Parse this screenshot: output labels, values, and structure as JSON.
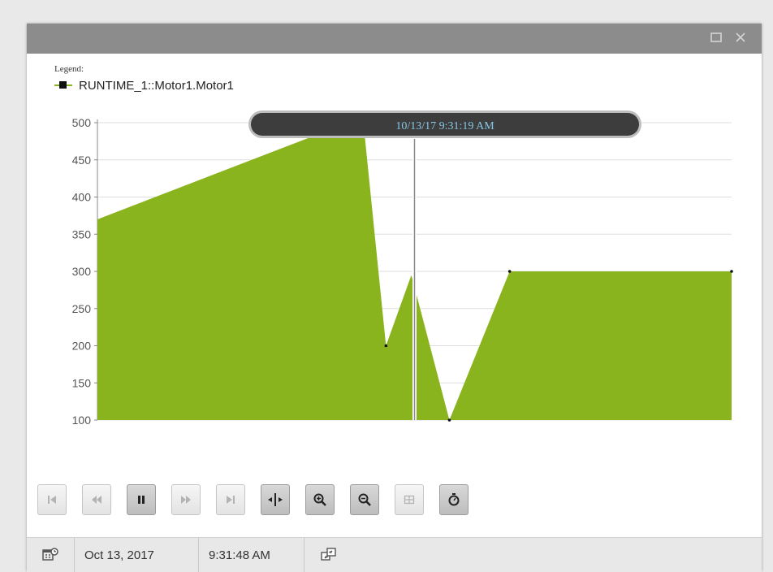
{
  "window": {
    "maximize_icon": "maximize-icon",
    "close_icon": "close-icon"
  },
  "legend": {
    "title": "Legend:",
    "items": [
      {
        "label": "RUNTIME_1::Motor1.Motor1",
        "color": "#8ab41e",
        "marker": "#111111"
      }
    ]
  },
  "cursor": {
    "timestamp": "10/13/17 9:31:19 AM"
  },
  "chart_data": {
    "type": "area",
    "series": [
      {
        "name": "RUNTIME_1::Motor1.Motor1",
        "color": "#8ab41e",
        "points": [
          [
            0,
            370
          ],
          [
            0.38,
            495
          ],
          [
            0.42,
            495
          ],
          [
            0.455,
            200
          ],
          [
            0.495,
            295
          ],
          [
            0.555,
            100
          ],
          [
            0.65,
            300
          ],
          [
            1.0,
            300
          ]
        ],
        "marked_points": [
          [
            0.455,
            200
          ],
          [
            0.555,
            100
          ],
          [
            0.65,
            300
          ],
          [
            1.0,
            300
          ]
        ]
      }
    ],
    "ylim": [
      100,
      500
    ],
    "yticks": [
      100,
      150,
      200,
      250,
      300,
      350,
      400,
      450,
      500
    ],
    "grid": true,
    "cursor_x": 0.5
  },
  "toolbar": {
    "buttons": [
      {
        "name": "first-button",
        "icon": "skip-first-icon",
        "disabled": true
      },
      {
        "name": "rewind-button",
        "icon": "rewind-icon",
        "disabled": true
      },
      {
        "name": "pause-button",
        "icon": "pause-icon",
        "active": true
      },
      {
        "name": "fast-forward-button",
        "icon": "fast-forward-icon",
        "disabled": true
      },
      {
        "name": "last-button",
        "icon": "skip-last-icon",
        "disabled": true
      },
      {
        "name": "cursor-button",
        "icon": "cursor-icon",
        "active": true
      },
      {
        "name": "zoom-in-button",
        "icon": "zoom-in-icon",
        "active": true
      },
      {
        "name": "zoom-out-button",
        "icon": "zoom-out-icon",
        "active": true
      },
      {
        "name": "table-button",
        "icon": "table-icon",
        "disabled": true
      },
      {
        "name": "timer-button",
        "icon": "stopwatch-icon",
        "active": true
      }
    ]
  },
  "status": {
    "date": "Oct 13, 2017",
    "time": "9:31:48 AM",
    "calendar_icon": "calendar-clock-icon",
    "sync_icon": "sync-windows-icon"
  }
}
